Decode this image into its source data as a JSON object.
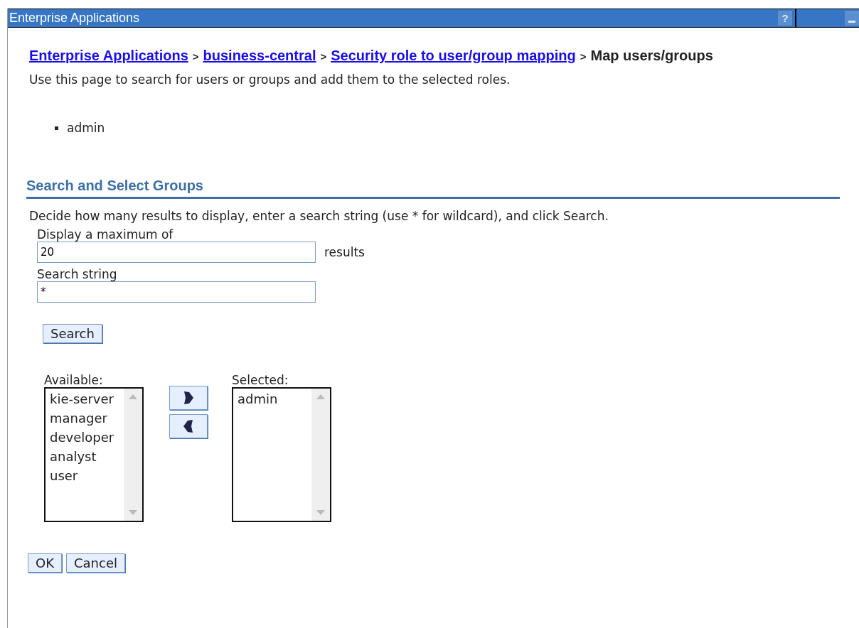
{
  "window": {
    "title": "Enterprise Applications",
    "help_button": "?"
  },
  "breadcrumb": {
    "links": [
      "Enterprise Applications",
      "business-central",
      "Security role to user/group mapping"
    ],
    "separator": ">",
    "current": "Map users/groups"
  },
  "description": "Use this page to search for users or groups and add them to the selected roles.",
  "roles": [
    "admin"
  ],
  "section": {
    "title": "Search and Select Groups",
    "instructions": "Decide how many results to display, enter a search string (use * for wildcard), and click Search."
  },
  "max_results": {
    "label": "Display a maximum of",
    "value": "20",
    "suffix": "results"
  },
  "search_string": {
    "label": "Search string",
    "value": "*"
  },
  "search_button": "Search",
  "available": {
    "label": "Available:",
    "items": [
      "kie-server",
      "manager",
      "developer",
      "analyst",
      "user"
    ]
  },
  "selected": {
    "label": "Selected:",
    "items": [
      "admin"
    ]
  },
  "buttons": [
    "OK",
    "Cancel"
  ]
}
